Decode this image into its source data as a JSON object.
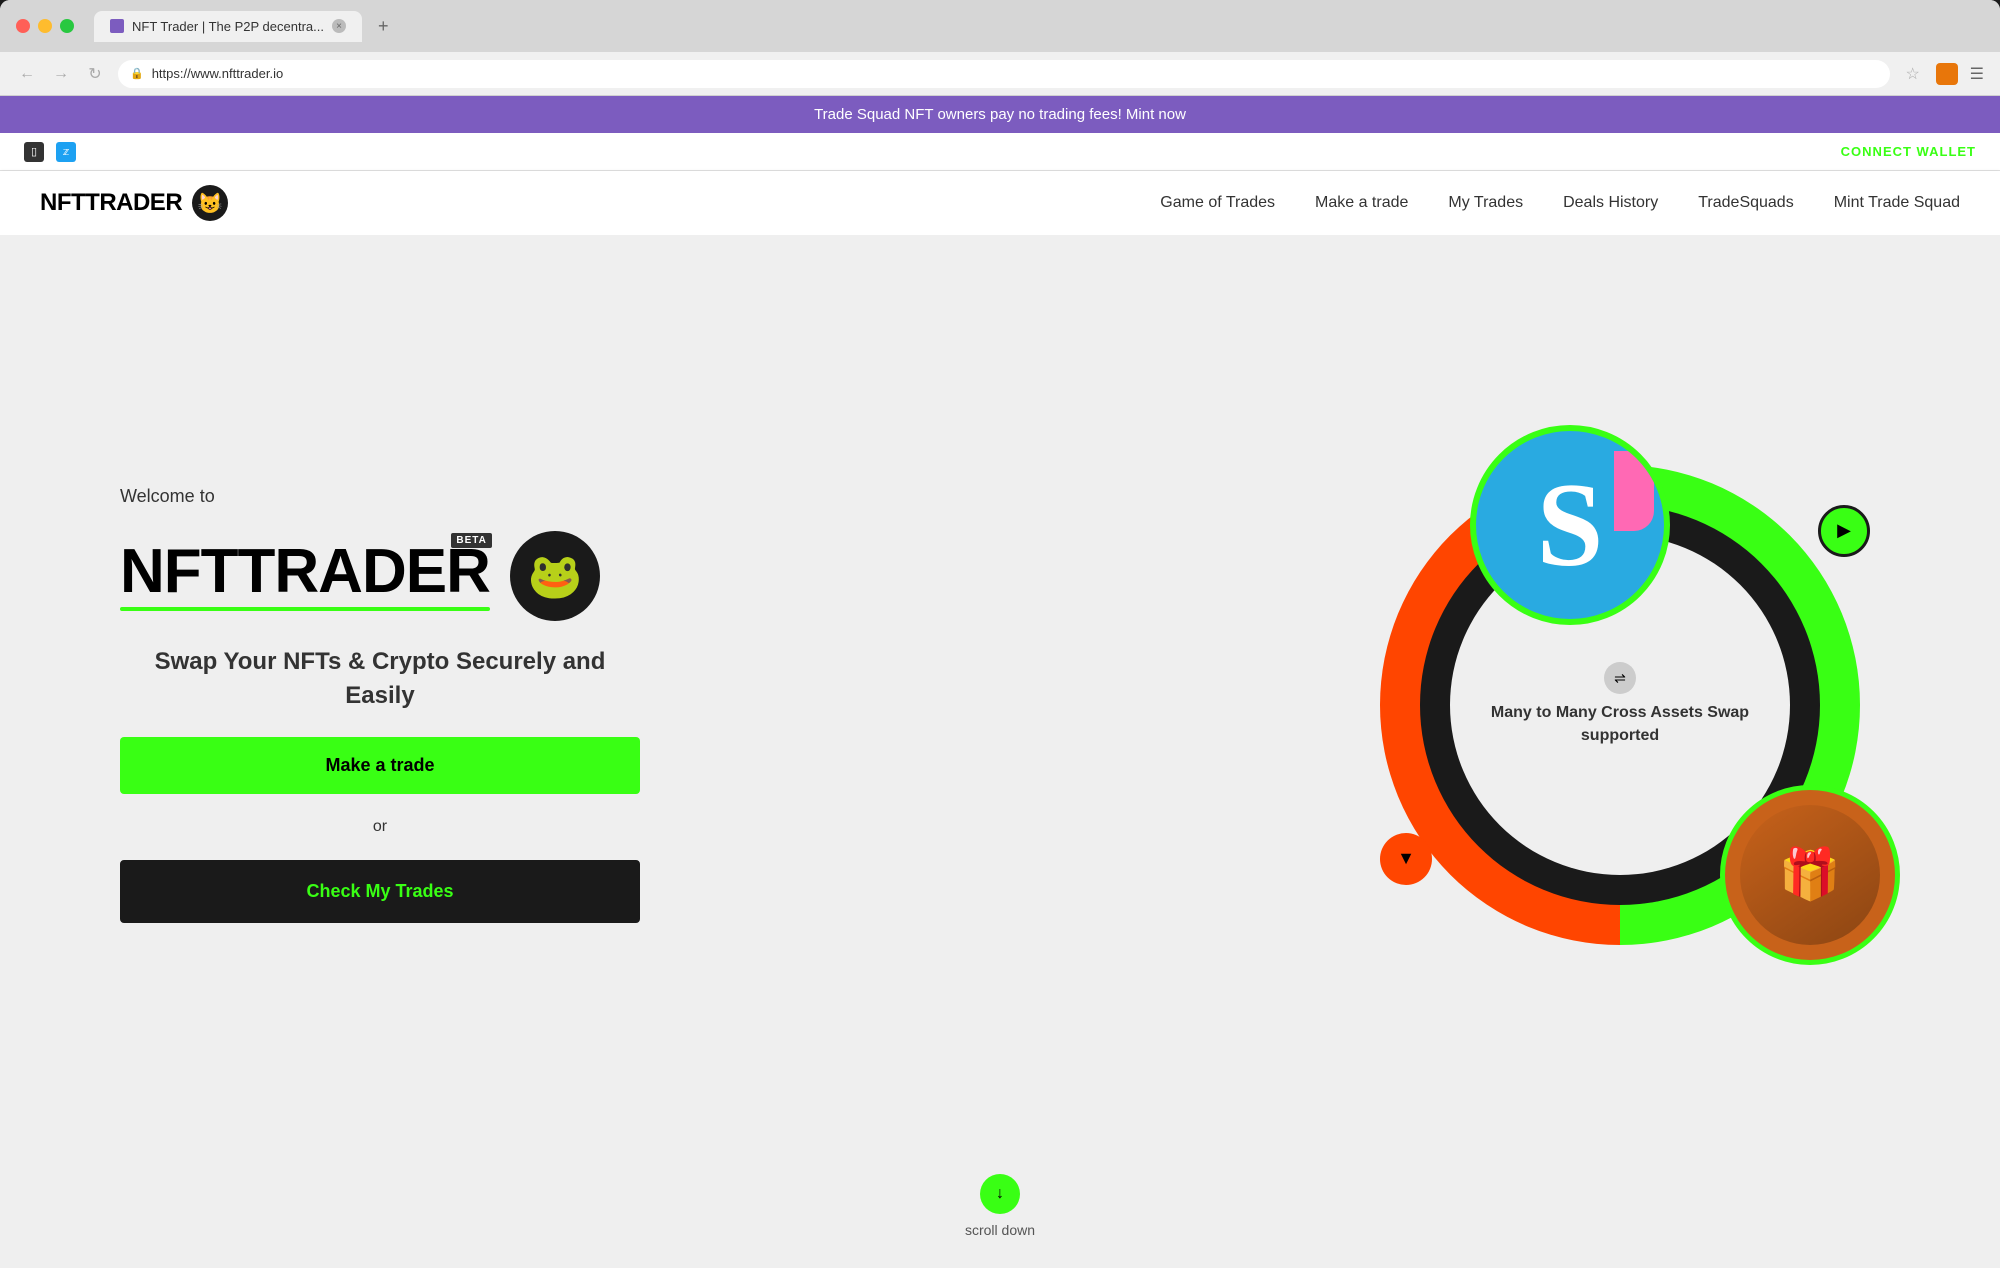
{
  "browser": {
    "tab_title": "NFT Trader | The P2P decentra...",
    "url": "https://www.nfttrader.io",
    "tab_close": "×",
    "tab_new": "+"
  },
  "banner": {
    "text": "Trade Squad NFT owners pay no trading fees! Mint now"
  },
  "utility_bar": {
    "connect_wallet": "CONNECT WALLET"
  },
  "nav": {
    "logo_text": "NFTTRADER",
    "links": [
      {
        "label": "Game of Trades",
        "id": "game-of-trades"
      },
      {
        "label": "Make a trade",
        "id": "make-a-trade"
      },
      {
        "label": "My Trades",
        "id": "my-trades"
      },
      {
        "label": "Deals History",
        "id": "deals-history"
      },
      {
        "label": "TradeSquads",
        "id": "tradesquads"
      },
      {
        "label": "Mint Trade Squad",
        "id": "mint-trade-squad"
      }
    ]
  },
  "hero": {
    "welcome": "Welcome to",
    "brand": "NFTTRADER",
    "beta_badge": "BETA",
    "tagline": "Swap Your NFTs & Crypto Securely and Easily",
    "make_trade_label": "Make a trade",
    "or_label": "or",
    "check_trades_label": "Check My Trades"
  },
  "circle": {
    "center_text_line1": "Many to Many Cross Assets Swap",
    "center_text_line2": "supported",
    "arrow_up": "▶",
    "arrow_down": "▼"
  },
  "scroll": {
    "label": "scroll down",
    "arrow": "↓"
  }
}
